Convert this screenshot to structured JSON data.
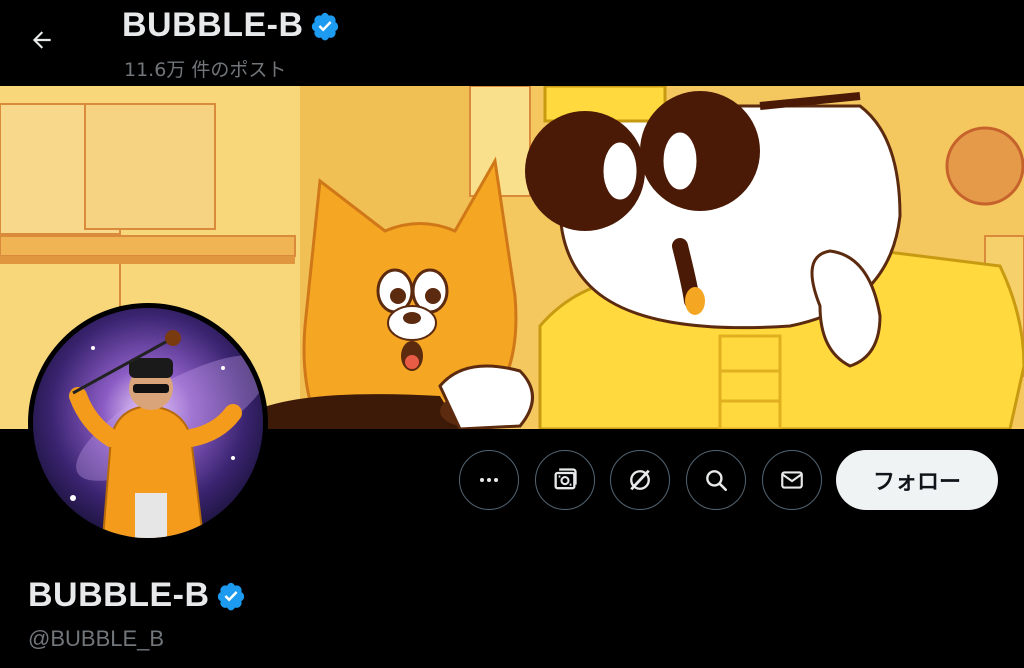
{
  "header": {
    "title": "BUBBLE-B",
    "post_count": "11.6万 件のポスト"
  },
  "profile": {
    "name": "BUBBLE-B",
    "handle": "@BUBBLE_B",
    "verified": true
  },
  "actions": {
    "buttons": [
      {
        "icon": "more-icon"
      },
      {
        "icon": "subscriptions-icon"
      },
      {
        "icon": "grok-icon"
      },
      {
        "icon": "search-icon"
      },
      {
        "icon": "message-icon"
      }
    ],
    "follow_label": "フォロー"
  },
  "colors": {
    "background": "#000000",
    "verified_blue": "#1d9bf0",
    "secondary_text": "#71767b",
    "follow_button_bg": "#eff3f4"
  }
}
